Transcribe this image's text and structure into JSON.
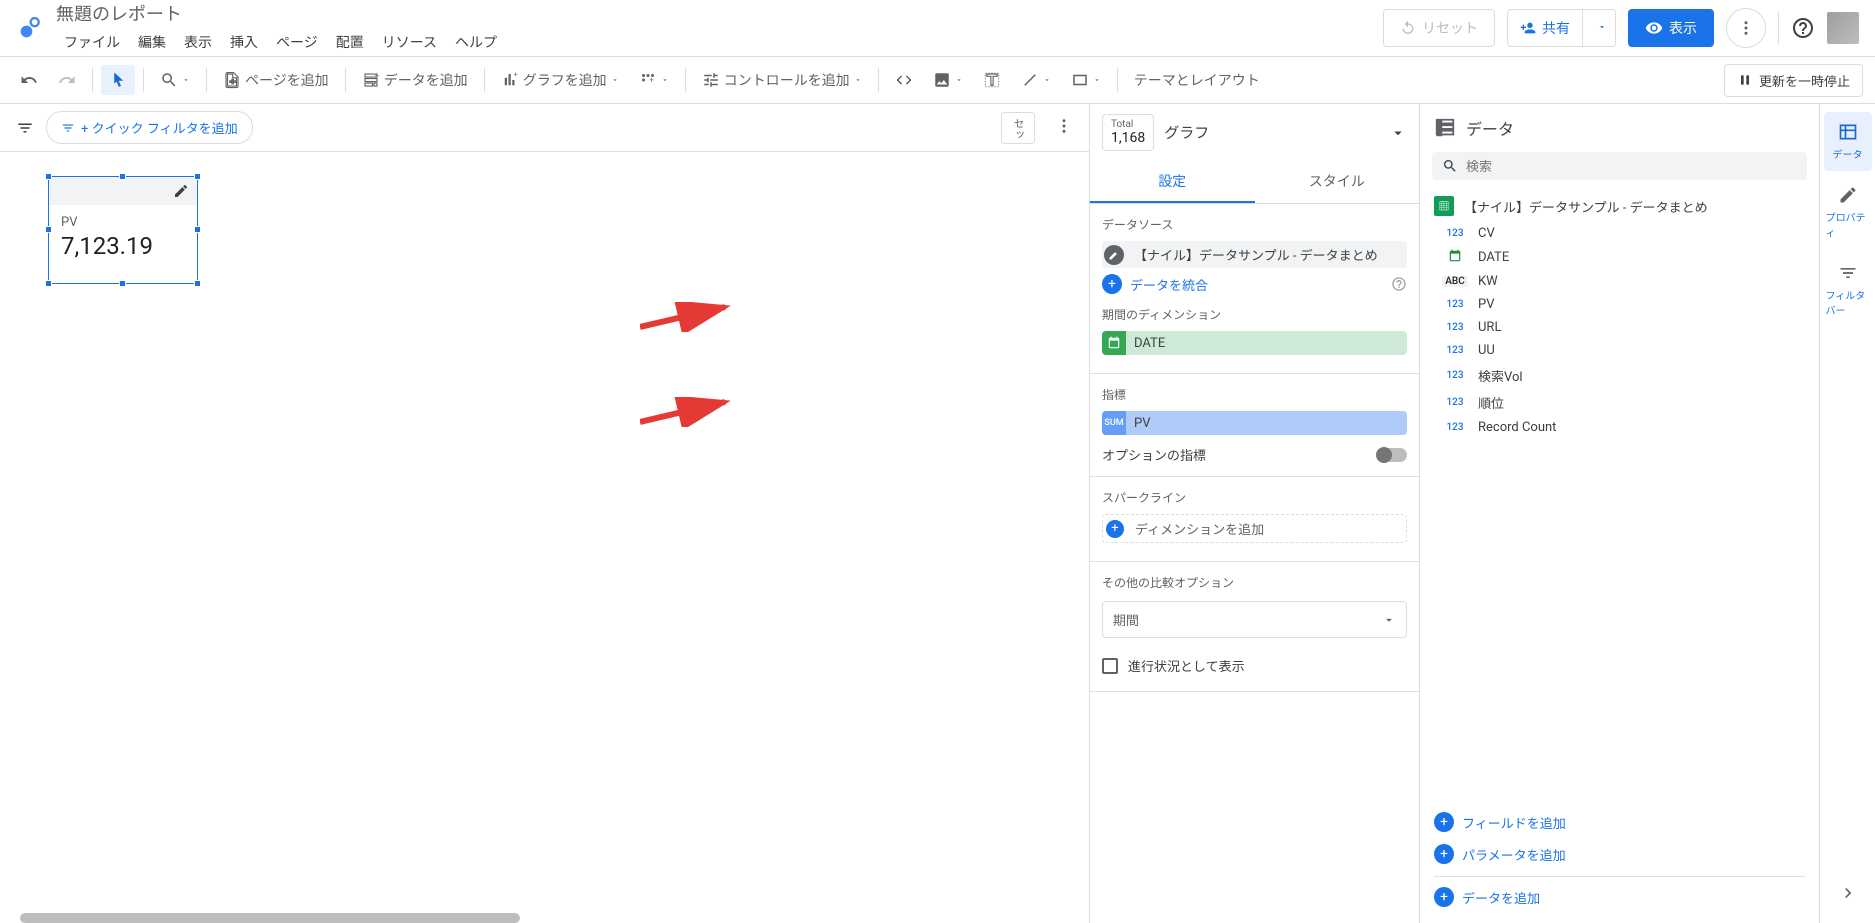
{
  "header": {
    "title": "無題のレポート",
    "menus": [
      "ファイル",
      "編集",
      "表示",
      "挿入",
      "ページ",
      "配置",
      "リソース",
      "ヘルプ"
    ],
    "reset": "リセット",
    "share": "共有",
    "view": "表示"
  },
  "toolbar": {
    "add_page": "ページを追加",
    "add_data": "データを追加",
    "add_chart": "グラフを追加",
    "add_control": "コントロールを追加",
    "theme_layout": "テーマとレイアウト",
    "pause": "更新を一時停止"
  },
  "filter_bar": {
    "add_quick_filter": "+ クイック フィルタを追加",
    "reset_pill": "セッ"
  },
  "scorecard": {
    "label": "PV",
    "value": "7,123.19"
  },
  "config": {
    "total_label": "Total",
    "total_value": "1,168",
    "chart_type": "グラフ",
    "tabs": {
      "setup": "設定",
      "style": "スタイル"
    },
    "sec_datasource": "データソース",
    "datasource_name": "【ナイル】データサンプル - データまとめ",
    "blend_data": "データを統合",
    "sec_date_dim": "期間のディメンション",
    "date_dim": "DATE",
    "sec_metric": "指標",
    "metric_agg": "SUM",
    "metric_name": "PV",
    "optional_metrics": "オプションの指標",
    "sec_sparkline": "スパークライン",
    "add_dimension": "ディメンションを追加",
    "sec_compare": "その他の比較オプション",
    "period": "期間",
    "show_progress": "進行状況として表示"
  },
  "data_panel": {
    "title": "データ",
    "search_placeholder": "検索",
    "datasource": "【ナイル】データサンプル - データまとめ",
    "fields": [
      {
        "type": "123",
        "cls": "ft-num",
        "name": "CV"
      },
      {
        "type": "📅",
        "cls": "ft-date",
        "name": "DATE"
      },
      {
        "type": "ABC",
        "cls": "ft-text",
        "name": "KW"
      },
      {
        "type": "123",
        "cls": "ft-num",
        "name": "PV"
      },
      {
        "type": "123",
        "cls": "ft-num",
        "name": "URL"
      },
      {
        "type": "123",
        "cls": "ft-num",
        "name": "UU"
      },
      {
        "type": "123",
        "cls": "ft-num",
        "name": "検索Vol"
      },
      {
        "type": "123",
        "cls": "ft-num",
        "name": "順位"
      },
      {
        "type": "123",
        "cls": "ft-num",
        "name": "Record Count"
      }
    ],
    "add_field": "フィールドを追加",
    "add_param": "パラメータを追加",
    "add_data": "データを追加"
  },
  "right_tabs": {
    "data": "データ",
    "properties": "プロパティ",
    "filter_bar": "フィルタバー"
  }
}
